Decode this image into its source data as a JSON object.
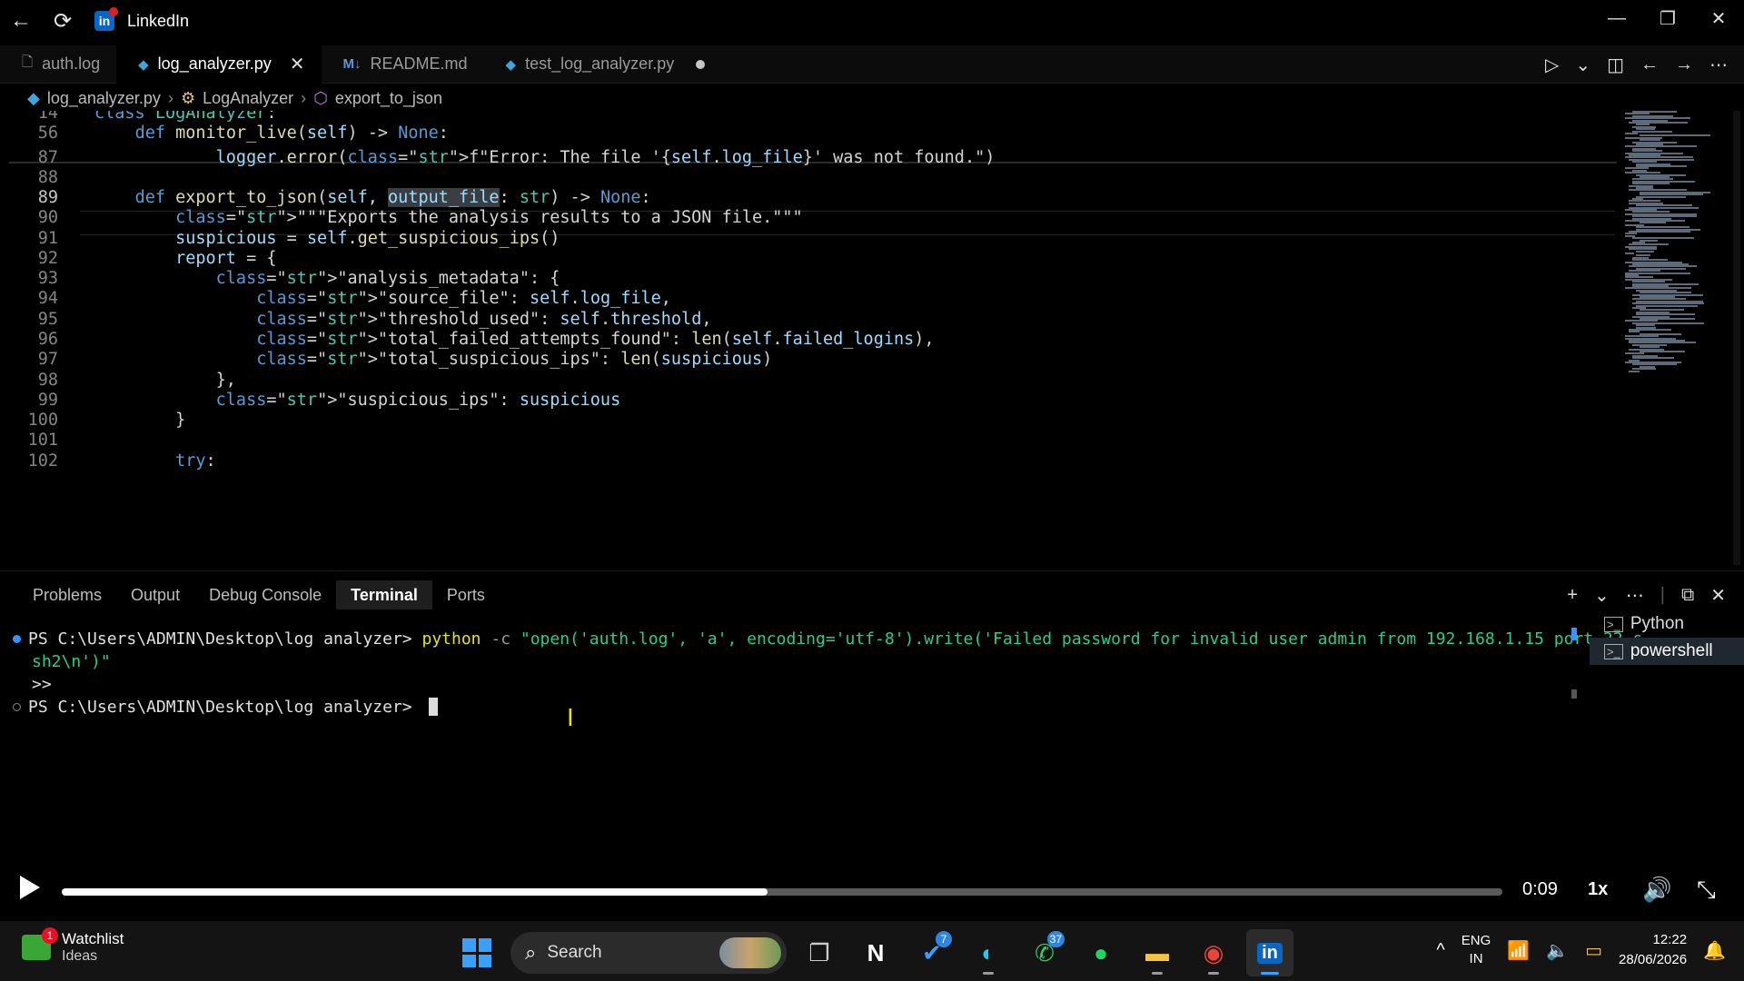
{
  "window": {
    "title": "LinkedIn",
    "app_icon_letter": "in"
  },
  "tabs": [
    {
      "label": "auth.log",
      "icon": "file-icon"
    },
    {
      "label": "log_analyzer.py",
      "icon": "python-icon",
      "active": true
    },
    {
      "label": "README.md",
      "icon": "markdown-icon",
      "icon_text": "M↓"
    },
    {
      "label": "test_log_analyzer.py",
      "icon": "python-icon",
      "dirty": true
    }
  ],
  "breadcrumb": {
    "file": "log_analyzer.py",
    "class": "LogAnalyzer",
    "method": "export_to_json"
  },
  "code_lines": [
    {
      "n": "14",
      "text": "class LogAnalyzer:"
    },
    {
      "n": "56",
      "text": "    def monitor_live(self) -> None:"
    },
    {
      "n": "87",
      "text": "            logger.error(f\"Error: The file '{self.log_file}' was not found.\")"
    },
    {
      "n": "88",
      "text": ""
    },
    {
      "n": "89",
      "text": "    def export_to_json(self, output_file: str) -> None:"
    },
    {
      "n": "90",
      "text": "        \"\"\"Exports the analysis results to a JSON file.\"\"\""
    },
    {
      "n": "91",
      "text": "        suspicious = self.get_suspicious_ips()"
    },
    {
      "n": "92",
      "text": "        report = {"
    },
    {
      "n": "93",
      "text": "            \"analysis_metadata\": {"
    },
    {
      "n": "94",
      "text": "                \"source_file\": self.log_file,"
    },
    {
      "n": "95",
      "text": "                \"threshold_used\": self.threshold,"
    },
    {
      "n": "96",
      "text": "                \"total_failed_attempts_found\": len(self.failed_logins),"
    },
    {
      "n": "97",
      "text": "                \"total_suspicious_ips\": len(suspicious)"
    },
    {
      "n": "98",
      "text": "            },"
    },
    {
      "n": "99",
      "text": "            \"suspicious_ips\": suspicious"
    },
    {
      "n": "100",
      "text": "        }"
    },
    {
      "n": "101",
      "text": ""
    },
    {
      "n": "102",
      "text": "        try:"
    }
  ],
  "panel": {
    "tabs": [
      "Problems",
      "Output",
      "Debug Console",
      "Terminal",
      "Ports"
    ],
    "active_tab": "Terminal"
  },
  "terminal": {
    "line1_prompt": "PS C:\\Users\\ADMIN\\Desktop\\log analyzer> ",
    "line1_cmd": "python",
    "line1_arg": " -c ",
    "line1_str": "\"open('auth.log', 'a', encoding='utf-8').write('Failed password for invalid user admin from 192.168.1.15 port 22 s",
    "line2": "sh2\\n')\"",
    "line3": ">>",
    "line4_prompt": "PS C:\\Users\\ADMIN\\Desktop\\log analyzer> "
  },
  "terminal_list": [
    "Python",
    "powershell"
  ],
  "video": {
    "time": "0:09",
    "speed": "1x",
    "progress": 0.49
  },
  "taskbar": {
    "widget_title": "Watchlist",
    "widget_subtitle": "Ideas",
    "widget_badge": "1",
    "search_label": "Search",
    "todo_badge": "7",
    "whatsapp_badge": "37",
    "lang_line1": "ENG",
    "lang_line2": "IN",
    "time": "12:22",
    "date": "28/06/2026"
  }
}
